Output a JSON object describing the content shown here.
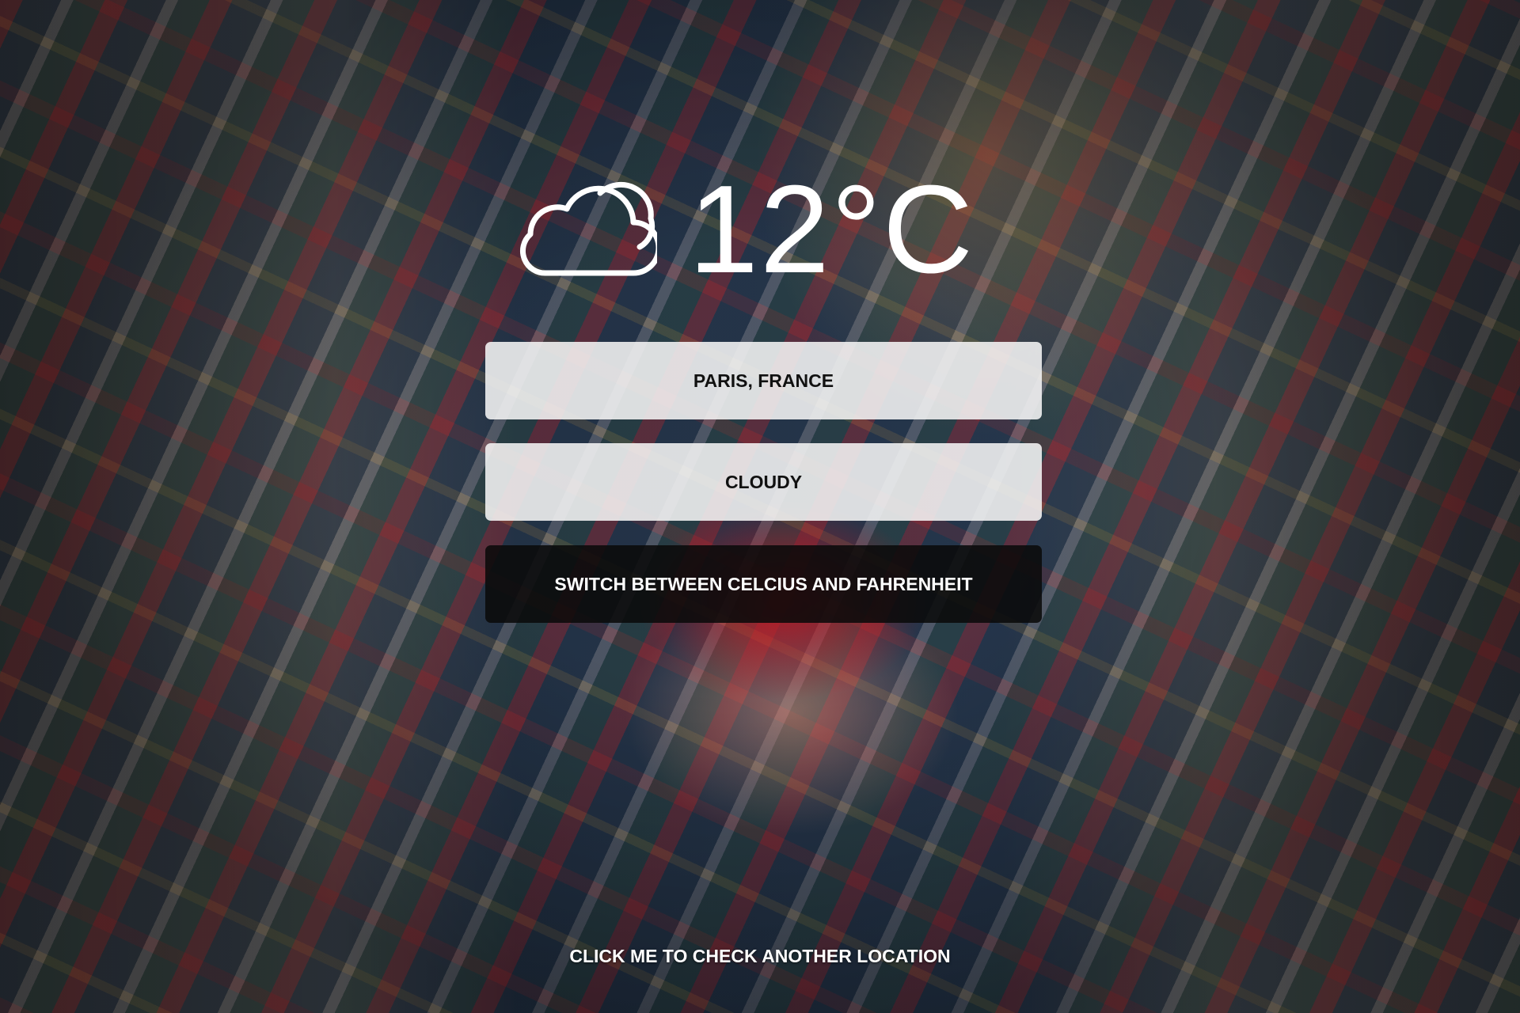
{
  "weather": {
    "icon": "cloud-icon",
    "temperature": "12°C",
    "location": "PARIS, FRANCE",
    "condition": "CLOUDY"
  },
  "actions": {
    "switch_units_label": "SWITCH BETWEEN CELCIUS AND FAHRENHEIT",
    "check_location_label": "CLICK ME TO CHECK ANOTHER LOCATION"
  },
  "colors": {
    "text_light": "#ffffff",
    "card_light": "#f5f5f5",
    "card_dark": "#0a0a0a",
    "text_dark": "#111111"
  }
}
